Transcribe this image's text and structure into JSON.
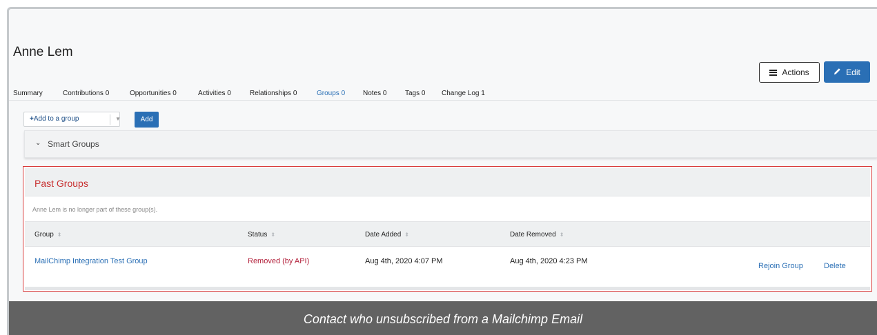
{
  "contact": {
    "name": "Anne Lem"
  },
  "toolbar": {
    "actions_label": "Actions",
    "edit_label": "Edit"
  },
  "tabs": [
    {
      "label": "Summary",
      "active": false
    },
    {
      "label": "Contributions 0",
      "active": false
    },
    {
      "label": "Opportunities 0",
      "active": false
    },
    {
      "label": "Activities 0",
      "active": false
    },
    {
      "label": "Relationships 0",
      "active": false
    },
    {
      "label": "Groups 0",
      "active": true
    },
    {
      "label": "Notes 0",
      "active": false
    },
    {
      "label": "Tags 0",
      "active": false
    },
    {
      "label": "Change Log 1",
      "active": false
    }
  ],
  "add_group": {
    "select_label": "Add to a group",
    "add_button": "Add"
  },
  "smart_groups": {
    "label": "Smart Groups"
  },
  "past_groups": {
    "title": "Past Groups",
    "note": "Anne Lem is no longer part of these group(s).",
    "columns": [
      "Group",
      "Status",
      "Date Added",
      "Date Removed"
    ],
    "rows": [
      {
        "group": "MailChimp Integration Test Group",
        "status": "Removed (by API)",
        "date_added": "Aug 4th, 2020 4:07 PM",
        "date_removed": "Aug 4th, 2020 4:23 PM",
        "rejoin": "Rejoin Group",
        "delete": "Delete"
      }
    ]
  },
  "caption": "Contact who unsubscribed from a Mailchimp Email",
  "colors": {
    "primary": "#2a6fb5",
    "danger": "#c83030",
    "caption_bg": "#626262"
  }
}
